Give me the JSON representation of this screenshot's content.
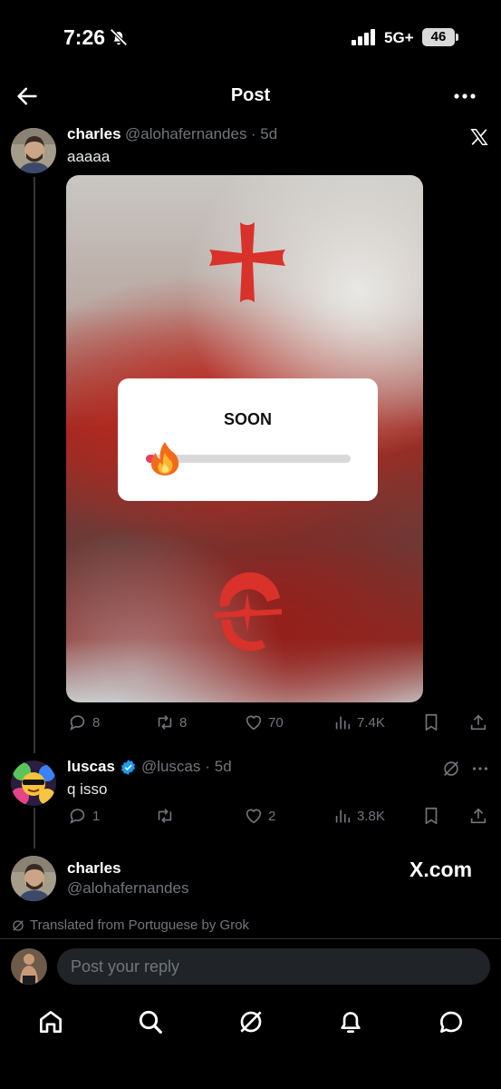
{
  "status": {
    "time": "7:26",
    "network": "5G+",
    "battery": "46"
  },
  "header": {
    "title": "Post"
  },
  "posts": [
    {
      "name": "charles",
      "handle": "@alohafernandes",
      "time": "· 5d",
      "text": "aaaaa",
      "media": {
        "card_title": "SOON",
        "slider_value": 0.05
      },
      "stats": {
        "replies": "8",
        "reposts": "8",
        "likes": "70",
        "views": "7.4K"
      }
    },
    {
      "name": "luscas",
      "handle": "@luscas",
      "time": "· 5d",
      "text": "q isso",
      "verified": true,
      "stats": {
        "replies": "1",
        "reposts": "",
        "likes": "2",
        "views": "3.8K"
      }
    }
  ],
  "reply_target": {
    "name": "charles",
    "handle": "@alohafernandes",
    "watermark": "X.com"
  },
  "translation_note": "Translated from Portuguese by Grok",
  "reply_box": {
    "placeholder": "Post your reply"
  },
  "colors": {
    "background": "#000000",
    "accent": "#1d9bf0",
    "muted": "#71767b",
    "cross_red": "#d8322a"
  },
  "icons": [
    "back-arrow-icon",
    "more-icon",
    "x-logo-icon",
    "reply-icon",
    "repost-icon",
    "like-icon",
    "views-icon",
    "bookmark-icon",
    "share-icon",
    "grok-icon",
    "home-icon",
    "search-icon",
    "notifications-icon",
    "messages-icon"
  ]
}
